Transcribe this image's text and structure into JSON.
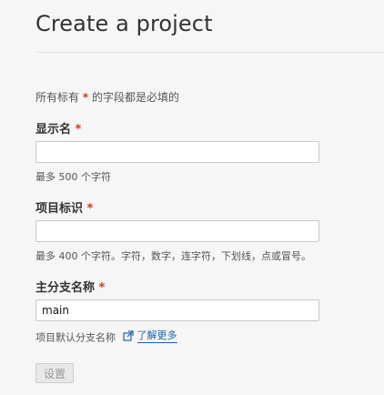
{
  "page": {
    "title": "Create a project",
    "required_hint_prefix": "所有标有",
    "required_hint_star": "*",
    "required_hint_suffix": "的字段都是必填的"
  },
  "fields": {
    "display_name": {
      "label": "显示名",
      "required_mark": "*",
      "value": "",
      "helper": "最多 500 个字符"
    },
    "identifier": {
      "label": "项目标识",
      "required_mark": "*",
      "value": "",
      "helper": "最多 400 个字符。字符，数字，连字符，下划线，点或冒号。"
    },
    "main_branch": {
      "label": "主分支名称",
      "required_mark": "*",
      "value": "main",
      "helper": "项目默认分支名称",
      "link_text": "了解更多",
      "link_icon": "external-link-icon"
    }
  },
  "actions": {
    "submit_label": "设置",
    "submit_state": "disabled"
  },
  "colors": {
    "required": "#d4351c",
    "link": "#1a62b5",
    "background": "#f6f6f6"
  }
}
